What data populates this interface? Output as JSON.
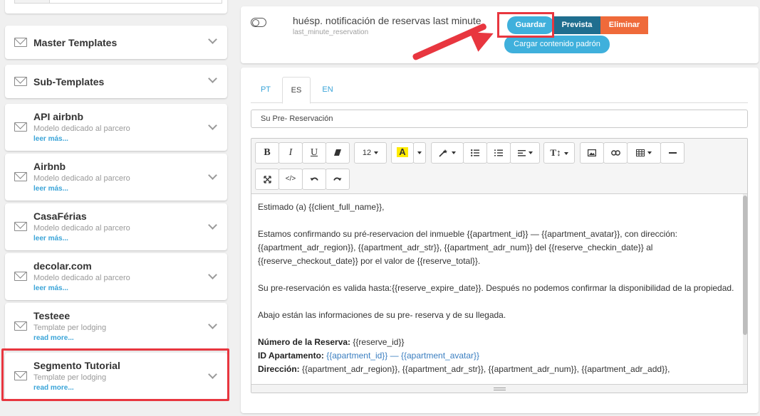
{
  "sidebar": {
    "items": [
      {
        "title": "Master Templates"
      },
      {
        "title": "Sub-Templates"
      },
      {
        "title": "API airbnb",
        "subtitle": "Modelo dedicado al parcero",
        "more": "leer más..."
      },
      {
        "title": "Airbnb",
        "subtitle": "Modelo dedicado al parcero",
        "more": "leer más..."
      },
      {
        "title": "CasaFérias",
        "subtitle": "Modelo dedicado al parcero",
        "more": "leer más..."
      },
      {
        "title": "decolar.com",
        "subtitle": "Modelo dedicado al parcero",
        "more": "leer más..."
      },
      {
        "title": "Testeee",
        "subtitle": "Template per lodging",
        "more": "read more..."
      },
      {
        "title": "Segmento Tutorial",
        "subtitle": "Template per lodging",
        "more": "read more..."
      }
    ]
  },
  "header": {
    "title": "huésp. notificación de reservas last minute",
    "key": "last_minute_reservation",
    "save_label": "Guardar",
    "preview_label": "Prevista",
    "delete_label": "Eliminar",
    "default_label": "Cargar contenido padrón"
  },
  "tabs": [
    {
      "label": "PT"
    },
    {
      "label": "ES"
    },
    {
      "label": "EN"
    }
  ],
  "subject_value": "Su Pre- Reservación",
  "toolbar": {
    "font_size": "12",
    "highlight_letter": "A",
    "code_label": "</>"
  },
  "body": {
    "greeting": "Estimado (a) {{client_full_name}},",
    "p1": "Estamos confirmando su pré-reservacion del inmueble {{apartment_id}} — {{apartment_avatar}}, con dirección: {{apartment_adr_region}}, {{apartment_adr_str}}, {{apartment_adr_num}} del {{reserve_checkin_date}} al {{reserve_checkout_date}} por el valor de {{reserve_total}}.",
    "p2": "Su pre-reservación es valida hasta:{{reserve_expire_date}}. Después no podemos confirmar la disponibilidad de la propiedad.",
    "p3": "Abajo están las informaciones de su pre- reserva y de su llegada.",
    "reserve_label": "Número de la Reserva:",
    "reserve_value": " {{reserve_id}}",
    "apt_label": "ID Apartamento:",
    "apt_value": " {{apartment_id}} — {{apartment_avatar}}",
    "addr_label": "Dirección:",
    "addr_value": " {{apartment_adr_region}}, {{apartment_adr_str}}, {{apartment_adr_num}}, {{apartment_adr_add}},"
  },
  "colors": {
    "accent": "#3fb0dc",
    "preview": "#1f6e8f",
    "delete": "#ef6a3a",
    "annotation": "#e8363f"
  }
}
